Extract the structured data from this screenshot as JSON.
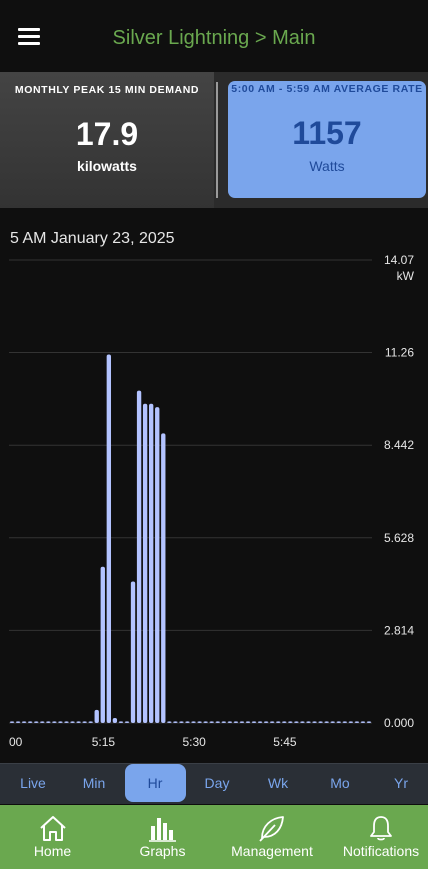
{
  "header": {
    "title": "Silver Lightning > Main",
    "menu_icon": "hamburger-menu-icon"
  },
  "stats": {
    "left": {
      "label": "MONTHLY PEAK 15 MIN DEMAND",
      "value": "17.9",
      "unit": "kilowatts"
    },
    "right": {
      "label": "5:00 AM - 5:59 AM AVERAGE RATE",
      "value": "1157",
      "unit": "Watts"
    }
  },
  "chart_title": "5 AM January 23, 2025",
  "chart_data": {
    "type": "bar",
    "ylabel": "kW",
    "ylim": [
      0,
      14.07
    ],
    "y_ticks": [
      "14.07",
      "11.26",
      "8.442",
      "5.628",
      "2.814",
      "0.000"
    ],
    "x_ticks": [
      "00",
      "5:15",
      "5:30",
      "5:45"
    ],
    "series": [
      {
        "values": [
          0.05,
          0.05,
          0.05,
          0.05,
          0.05,
          0.05,
          0.05,
          0.05,
          0.05,
          0.05,
          0.05,
          0.05,
          0.05,
          0.05,
          0.4,
          4.75,
          11.2,
          0.15,
          0.05,
          0.05,
          4.3,
          10.1,
          9.7,
          9.7,
          9.6,
          8.8,
          0.05,
          0.05,
          0.05,
          0.05,
          0.05,
          0.05,
          0.05,
          0.05,
          0.05,
          0.05,
          0.05,
          0.05,
          0.05,
          0.05,
          0.05,
          0.05,
          0.05,
          0.05,
          0.05,
          0.05,
          0.05,
          0.05,
          0.05,
          0.05,
          0.05,
          0.05,
          0.05,
          0.05,
          0.05,
          0.05,
          0.05,
          0.05,
          0.05,
          0.05
        ]
      }
    ],
    "bar_color": "#b3c3ff",
    "grid": true
  },
  "range_tabs": [
    {
      "label": "Live",
      "active": false
    },
    {
      "label": "Min",
      "active": false
    },
    {
      "label": "Hr",
      "active": true
    },
    {
      "label": "Day",
      "active": false
    },
    {
      "label": "Wk",
      "active": false
    },
    {
      "label": "Mo",
      "active": false
    },
    {
      "label": "Yr",
      "active": false
    }
  ],
  "nav": [
    {
      "label": "Home",
      "icon": "home-icon"
    },
    {
      "label": "Graphs",
      "icon": "bar-chart-icon"
    },
    {
      "label": "Management",
      "icon": "leaf-icon"
    },
    {
      "label": "Notifications",
      "icon": "bell-icon"
    }
  ],
  "colors": {
    "accent_green": "#6aa84f",
    "accent_blue": "#7aa5ec",
    "dark_blue": "#1f4a9a"
  }
}
